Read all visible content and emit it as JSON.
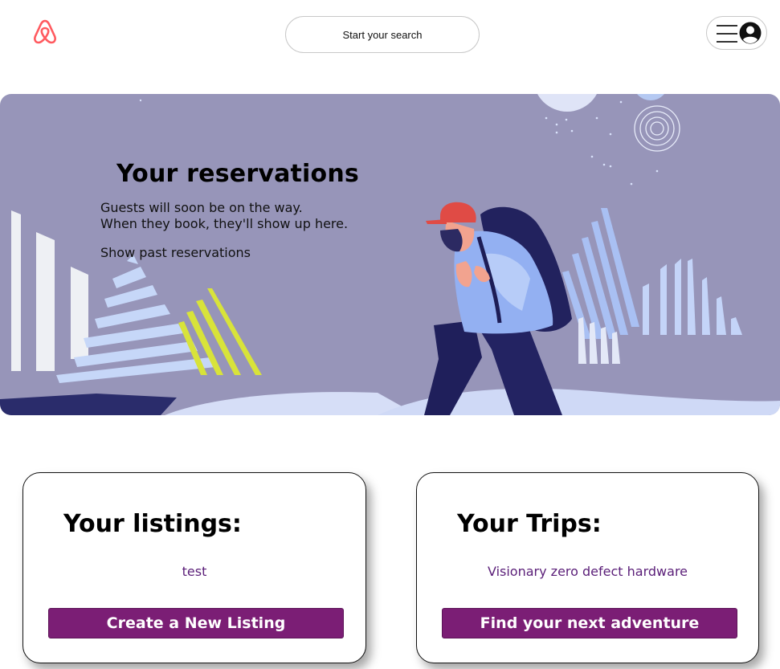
{
  "header": {
    "logo_icon": "airbnb-logo-icon",
    "search_label": "Start your search",
    "menu_icon": "hamburger-icon",
    "user_icon": "user-avatar-icon"
  },
  "banner": {
    "title": "Your reservations",
    "line1": "Guests will soon be on the way.",
    "line2": "When they book, they'll show up here.",
    "link": "Show past reservations",
    "illustration": "hiker-illustration"
  },
  "listings": {
    "title": "Your listings:",
    "items": [
      "test"
    ],
    "button": "Create a New Listing"
  },
  "trips": {
    "title": "Your Trips:",
    "items": [
      "Visionary zero defect hardware"
    ],
    "button": "Find your next adventure"
  },
  "colors": {
    "brand": "#ff5a5f",
    "banner_bg": "#9795b9",
    "button_bg": "#7b1e75",
    "link_text": "#5a1e78"
  }
}
